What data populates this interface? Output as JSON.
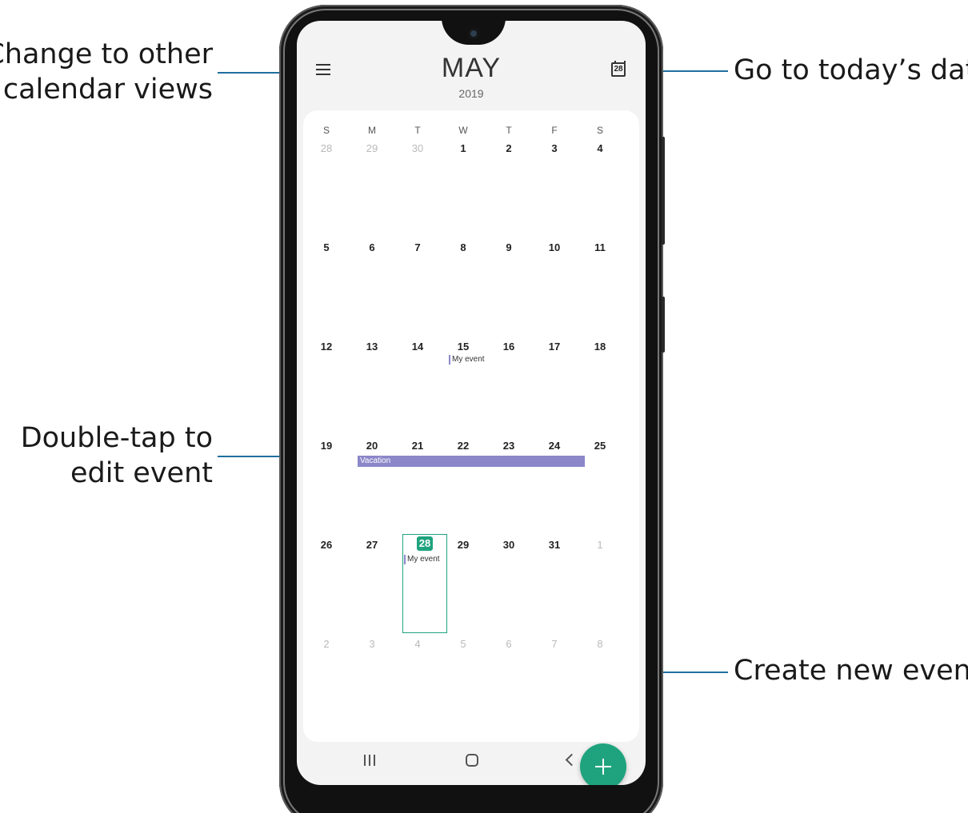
{
  "annotations": {
    "views_line1": "Change to other",
    "views_line2": "calendar views",
    "today": "Go to today’s date",
    "edit_line1": "Double-tap to",
    "edit_line2": "edit event",
    "create": "Create new event"
  },
  "header": {
    "month": "MAY",
    "year": "2019",
    "menu_icon": "hamburger-menu-icon",
    "today_icon": "calendar-today-icon",
    "today_icon_number": "28"
  },
  "calendar": {
    "weekdays": [
      "S",
      "M",
      "T",
      "W",
      "T",
      "F",
      "S"
    ],
    "weeks": [
      [
        "28",
        "29",
        "30",
        "1",
        "2",
        "3",
        "4"
      ],
      [
        "5",
        "6",
        "7",
        "8",
        "9",
        "10",
        "11"
      ],
      [
        "12",
        "13",
        "14",
        "15",
        "16",
        "17",
        "18"
      ],
      [
        "19",
        "20",
        "21",
        "22",
        "23",
        "24",
        "25"
      ],
      [
        "26",
        "27",
        "28",
        "29",
        "30",
        "31",
        "1"
      ],
      [
        "2",
        "3",
        "4",
        "5",
        "6",
        "7",
        "8"
      ]
    ],
    "today": "28",
    "events": {
      "may15": "My event",
      "vacation": "Vacation",
      "may28": "My event"
    }
  },
  "fab_icon": "plus-icon",
  "nav": {
    "recents_icon": "recent-apps-icon",
    "home_icon": "home-icon",
    "back_icon": "back-icon"
  },
  "colors": {
    "accent": "#1fa37e",
    "event": "#8b87c9",
    "leader_line": "#1f6fa0"
  }
}
